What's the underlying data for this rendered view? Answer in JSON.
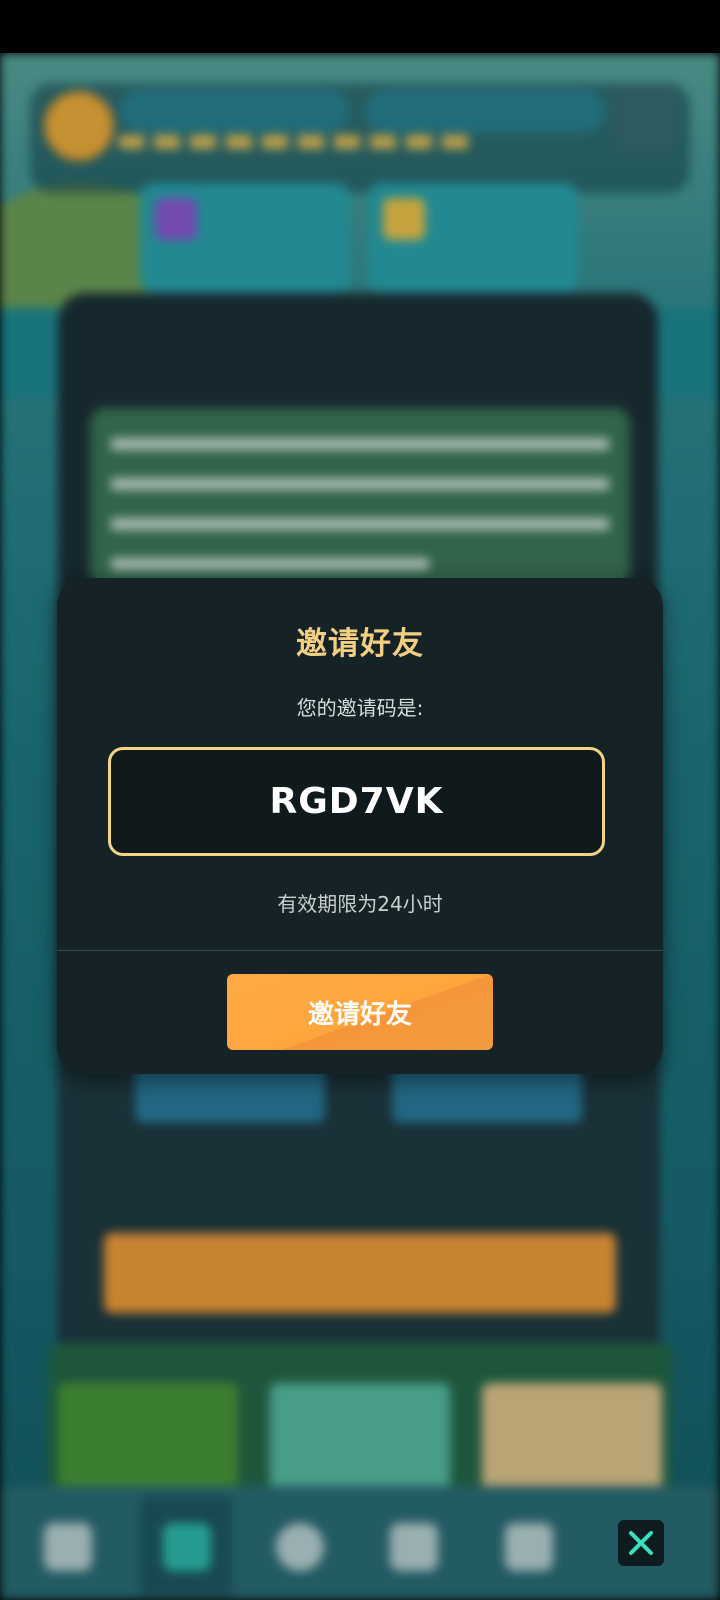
{
  "modal": {
    "title": "邀请好友",
    "subtitle": "您的邀请码是:",
    "invite_code": "RGD7VK",
    "validity": "有效期限为24小时",
    "button_label": "邀请好友",
    "accent_color": "#f3cf84",
    "button_color": "#ffa53e"
  },
  "icons": {
    "close": "close-icon"
  }
}
